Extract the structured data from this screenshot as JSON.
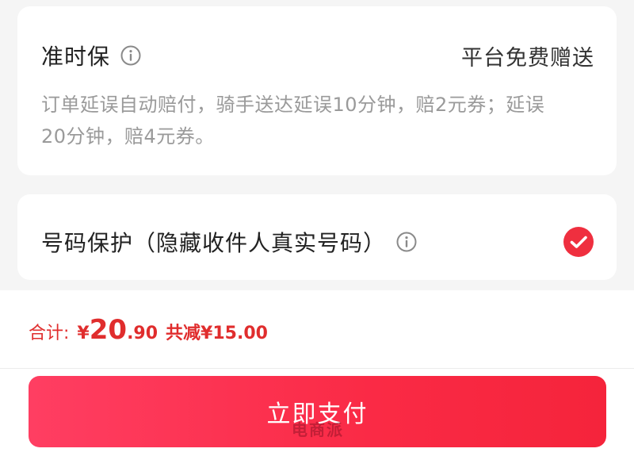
{
  "on_time_card": {
    "title": "准时保",
    "badge": "平台免费赠送",
    "description_line1": "订单延误自动赔付，骑手送达延误10分钟，赔2元券；延误",
    "description_line2": "20分钟，赔4元券。",
    "info_icon": "info-circle-icon"
  },
  "privacy_card": {
    "title": "号码保护（隐藏收件人真实号码）",
    "info_icon": "info-circle-icon",
    "checked": true,
    "check_icon": "check-circle-icon"
  },
  "summary": {
    "label": "合计:",
    "currency": "¥",
    "amount_integer": "20",
    "amount_decimal": ".90",
    "discount_text": "共减¥15.00"
  },
  "pay_button": {
    "label": "立即支付"
  },
  "watermark": {
    "text": "电商派"
  },
  "colors": {
    "accent": "#e02d2d",
    "button": "#fa2a45",
    "background": "#f5f5f5",
    "muted_text": "#9a9a9a"
  }
}
